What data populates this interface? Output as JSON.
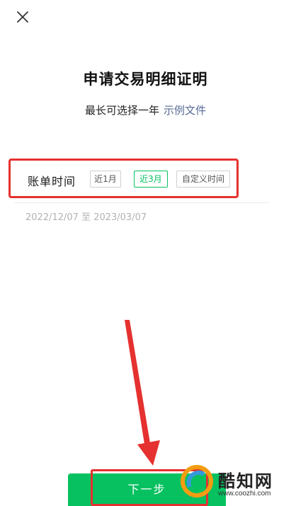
{
  "header": {
    "close_icon": "close-icon"
  },
  "title": "申请交易明细证明",
  "subtitle": {
    "text": "最长可选择一年",
    "link": "示例文件"
  },
  "period": {
    "label": "账单时间",
    "options": [
      "近1月",
      "近3月",
      "自定义时间"
    ],
    "selected": "近3月"
  },
  "date_range": "2022/12/07 至 2023/03/07",
  "footer": {
    "next_label": "下一步"
  },
  "watermark": {
    "brand": "酷知网",
    "url": "www.coozhi.com"
  },
  "colors": {
    "accent": "#07c160",
    "link": "#576b95",
    "highlight": "#e5312f"
  }
}
